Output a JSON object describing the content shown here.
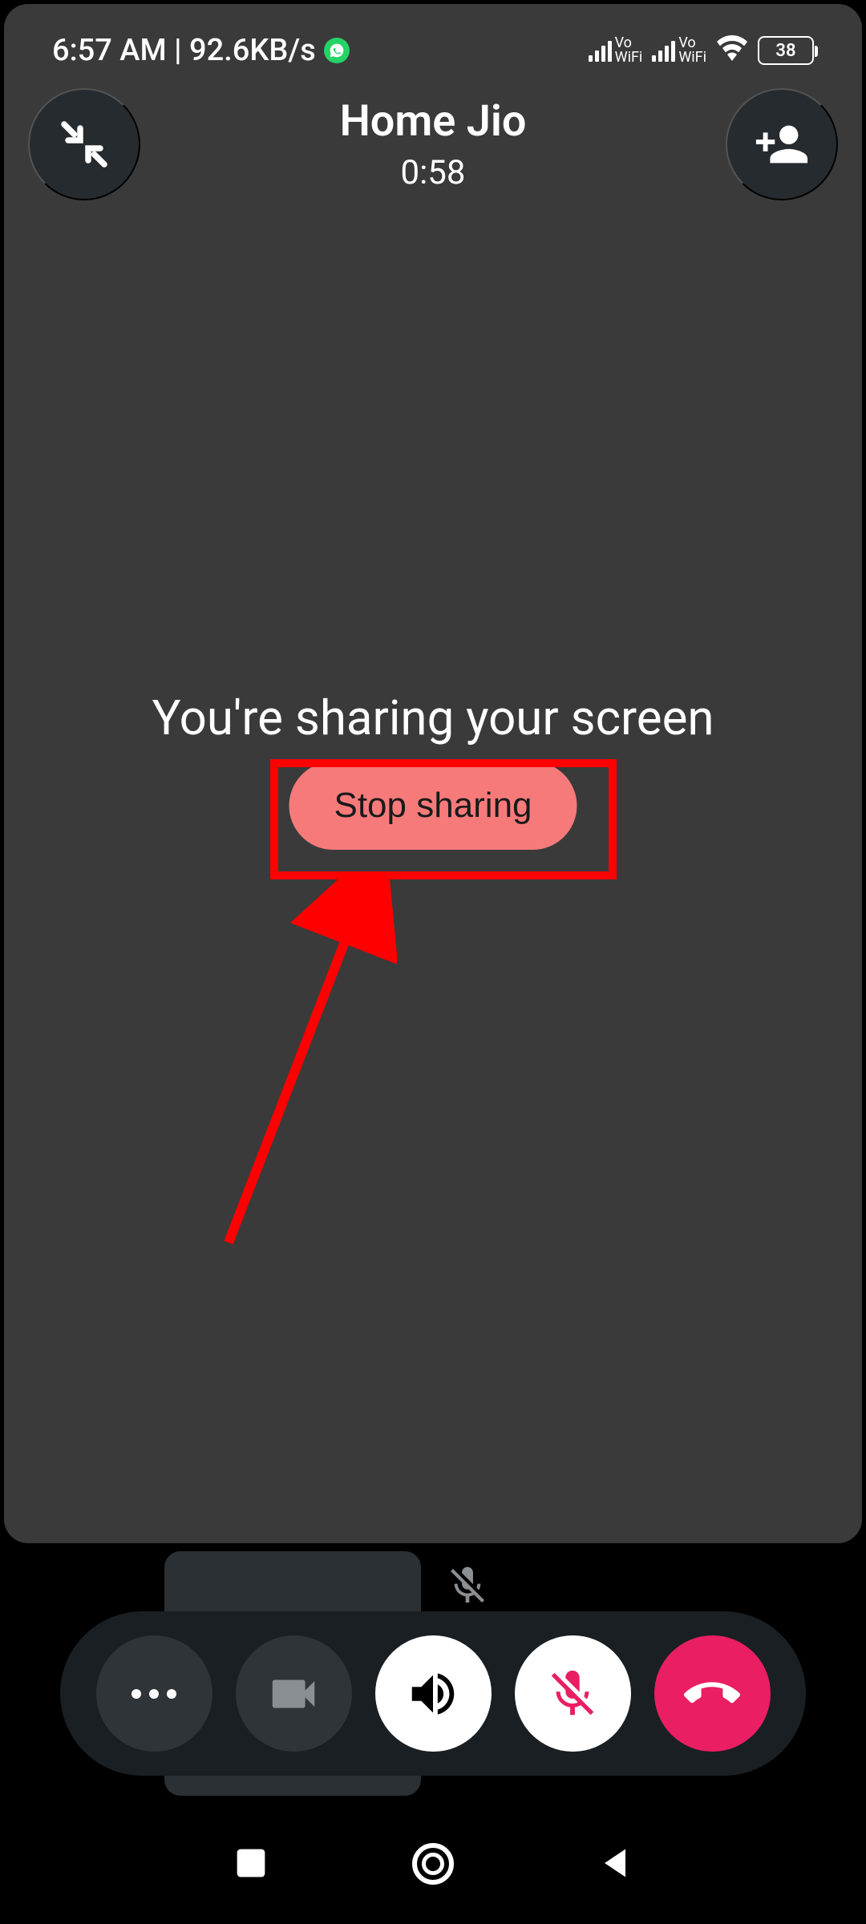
{
  "status_bar": {
    "time_data": "6:57 AM | 92.6KB/s",
    "battery": "38"
  },
  "call": {
    "contact_name": "Home Jio",
    "duration": "0:58"
  },
  "share": {
    "message": "You're sharing your screen",
    "stop_label": "Stop sharing"
  }
}
